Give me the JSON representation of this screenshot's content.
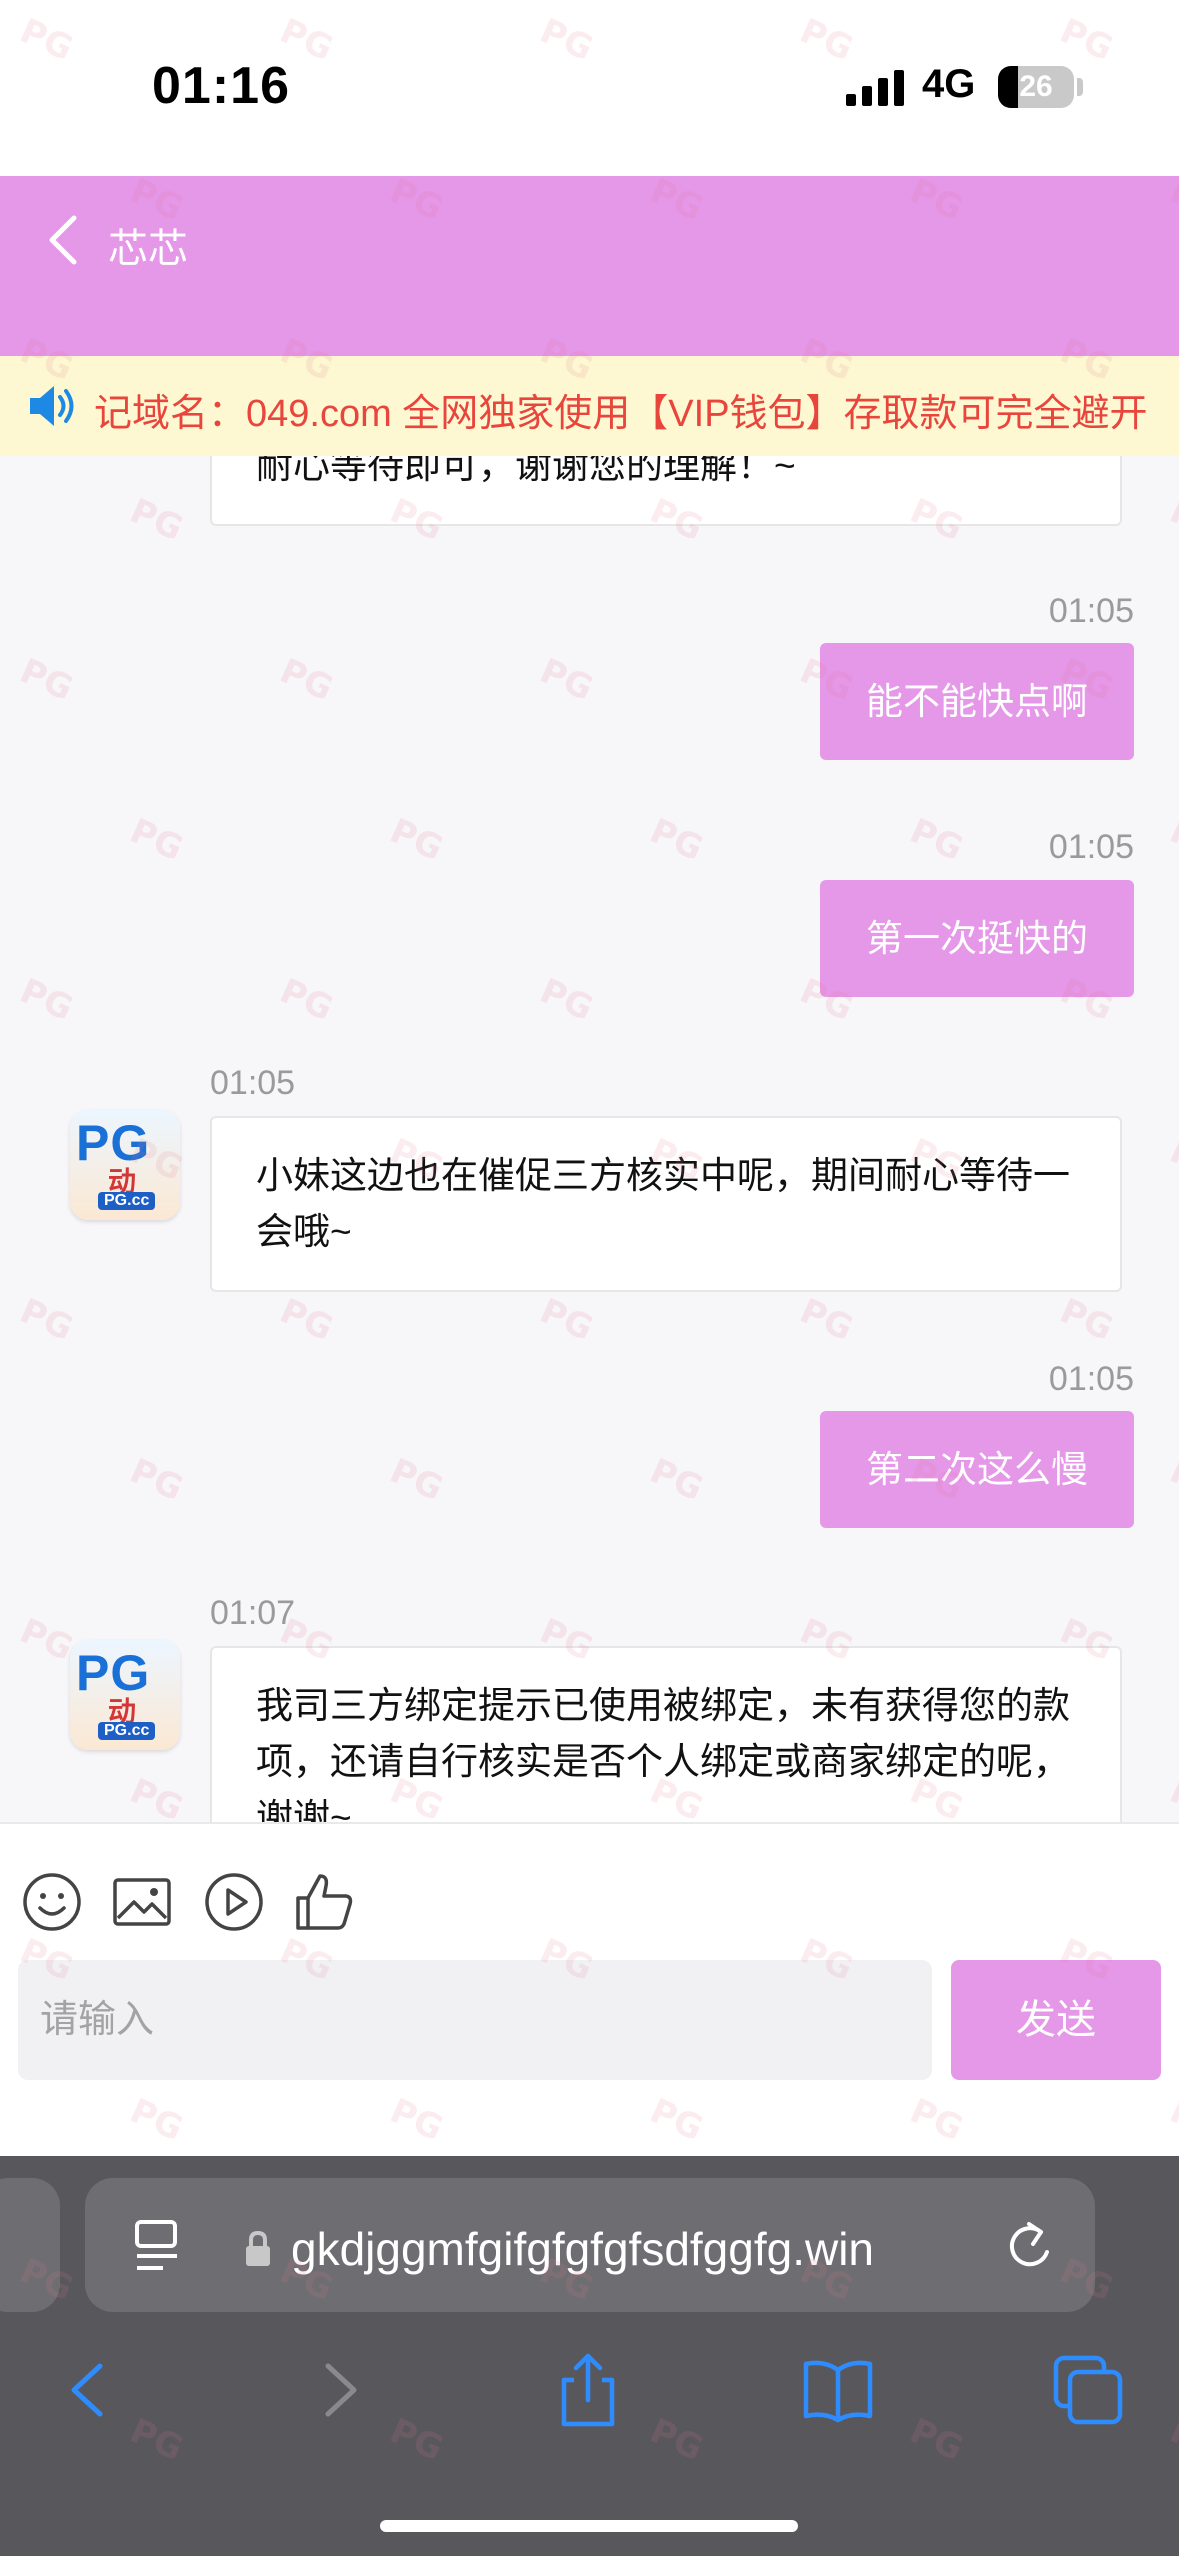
{
  "status_bar": {
    "time": "01:16",
    "network": "4G",
    "battery": "26",
    "battery_level": 0.26
  },
  "header": {
    "title": "芯芯"
  },
  "notice": {
    "text": "记域名：049.com 全网独家使用【VIP钱包】存取款可完全避开"
  },
  "messages": {
    "partial_top": "耐心等待即可，谢谢您的理解！~",
    "m1": {
      "time": "01:05",
      "text": "能不能快点啊"
    },
    "m2": {
      "time": "01:05",
      "text": "第一次挺快的"
    },
    "m3": {
      "time": "01:05",
      "text": "小妹这边也在催促三方核实中呢，期间耐心等待一会哦~"
    },
    "m4": {
      "time": "01:05",
      "text": "第二次这么慢"
    },
    "m5": {
      "time": "01:07",
      "text": "我司三方绑定提示已使用被绑定，未有获得您的款项，还请自行核实是否个人绑定或商家绑定的呢，谢谢~"
    }
  },
  "avatar": {
    "logo": "PG",
    "mid": "动",
    "sub": "PG.cc"
  },
  "composer": {
    "placeholder": "请输入",
    "send_label": "发送"
  },
  "browser": {
    "url": "gkdjggmfgifgfgfgfsdfggfg.win"
  },
  "watermark": "PG",
  "colors": {
    "accent": "#e597e8",
    "notice_bg": "#fdf8d2",
    "notice_text": "#e8453c"
  }
}
